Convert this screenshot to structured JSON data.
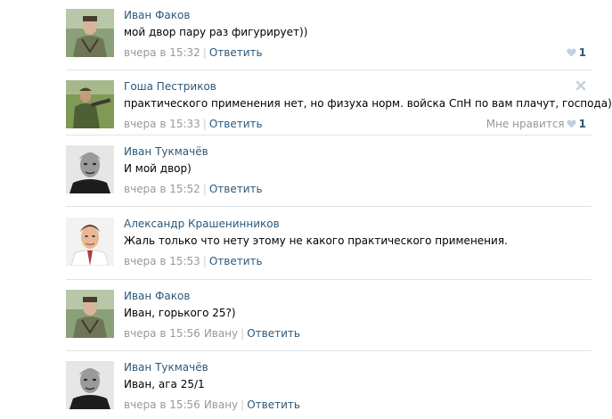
{
  "actions": {
    "reply_label": "Ответить",
    "like_label": "Мне нравится"
  },
  "comments": [
    {
      "author": "Иван Факов",
      "text": "мой двор пару раз фигурирует))",
      "time": "вчера в 15:32",
      "reply_to": "",
      "likes": "1",
      "avatar": "ivan-fakov"
    },
    {
      "author": "Гоша Пестриков",
      "text": "практического применения нет, но физуха норм. войска СпН по вам плачут, господа)",
      "time": "вчера в 15:33",
      "reply_to": "",
      "likes": "1",
      "avatar": "gosha-pestrikov"
    },
    {
      "author": "Иван Тукмачёв",
      "text": "И мой двор)",
      "time": "вчера в 15:52",
      "reply_to": "",
      "likes": "",
      "avatar": "ivan-tukmachev"
    },
    {
      "author": "Александр Крашенинников",
      "text": "Жаль только что нету этому не какого практического применения.",
      "time": "вчера в 15:53",
      "reply_to": "",
      "likes": "",
      "avatar": "alexander-krasheninnikov"
    },
    {
      "author": "Иван Факов",
      "text": "Иван, горького 25?)",
      "time": "вчера в 15:56",
      "reply_to": "Ивану",
      "likes": "",
      "avatar": "ivan-fakov"
    },
    {
      "author": "Иван Тукмачёв",
      "text": "Иван, ага 25/1",
      "time": "вчера в 15:56",
      "reply_to": "Ивану",
      "likes": "",
      "avatar": "ivan-tukmachev"
    }
  ]
}
